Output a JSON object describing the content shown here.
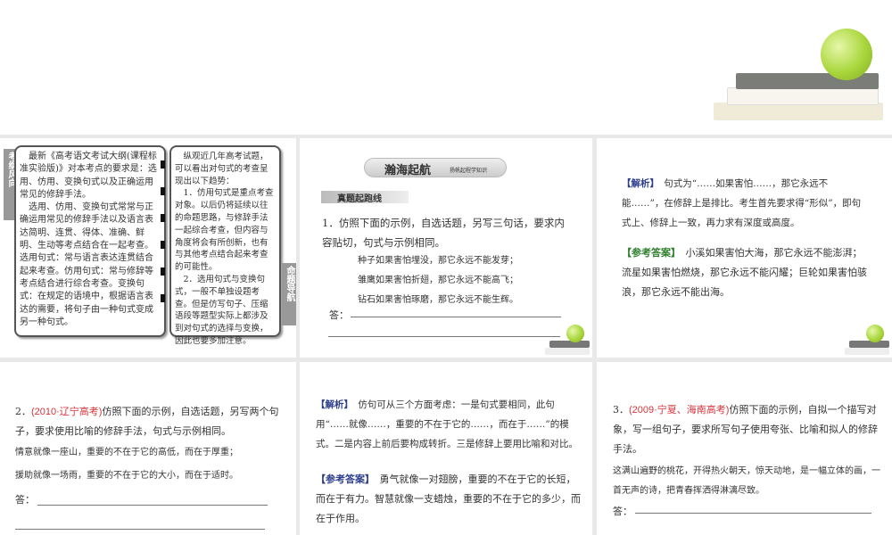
{
  "slide1": {
    "left_tab": "考纲风向",
    "right_tab": "命题导航",
    "left_text": [
      "　最新《高考语文考试大纲(课程标准实验版)》对本考点的要求是：选用、仿用、变换句式以及正确运用常见的修辞手法。",
      "　选用、仿用、变换句式常常与正确运用常见的修辞手法以及语言表达简明、连贯、得体、准确、鲜明、生动等考点结合在一起考查。选用句式：常与语言表达连贯结合起来考查。仿用句式：常与修辞等考点结合进行综合考查。变换句式：在规定的语境中，根据语言表达的需要，将句子由一种句式变成另一种句式。"
    ],
    "right_text": [
      "　纵观近几年高考试题，可以看出对句式的考查呈现出以下趋势：",
      "　1．仿用句式是重点考查对象。以后仍将延续以往的命题思路，与修辞手法一起综合考查，但内容与角度将会有所创新，也有与其他考点结合起来考查的可能性。",
      "　2．选用句式与变换句式，一般不单独设题考查。但是仿写句子、压缩语段等题型实际上都涉及到对句式的选择与变换，因此也要多加注意。"
    ]
  },
  "slide2": {
    "banner_title": "瀚海起航",
    "banner_sub": "扬帆起程学知识",
    "section": "真题起跑线",
    "question": "1．仿照下面的示例，自选话题，另写三句话，要求内容贴切，句式与示例相同。",
    "examples": [
      "种子如果害怕埋没，那它永远不能发芽；",
      "雏鹰如果害怕折翅，那它永远不能高飞；",
      "钻石如果害怕琢磨，那它永远不能生辉。"
    ],
    "answer_label": "答："
  },
  "slide3": {
    "analysis_label": "【解析】",
    "analysis": "句式为“……如果害怕……，那它永远不能……”，在修辞上是排比。考生首先要求得“形似”，即句式上、修辞上一致，再力求有深度或高度。",
    "answer_label": "【参考答案】",
    "answer": "小溪如果害怕大海，那它永远不能澎湃；流星如果害怕燃烧，那它永远不能闪耀；巨轮如果害怕骇浪，那它永远不能出海。"
  },
  "slide4": {
    "number": "2．",
    "source": "(2010·辽宁高考)",
    "question": "仿照下面的示例，自选话题，另写两个句子，要求使用比喻的修辞手法，句式与示例相同。",
    "examples": [
      "情意就像一座山，重要的不在于它的高低，而在于厚重；",
      "援助就像一场雨，重要的不在于它的大小，而在于适时。"
    ],
    "answer_label": "答："
  },
  "slide5": {
    "analysis_label": "【解析】",
    "analysis": "仿句可从三个方面考虑：一是句式要相同，此句用“……就像……，重要的不在于它的……，而在于……”的模式。二是内容上前后要构成转折。三是修辞上要用比喻和对比。",
    "answer_label": "【参考答案】",
    "answer": "勇气就像一对翅膀，重要的不在于它的长短，而在于有力。智慧就像一支蜡烛，重要的不在于它的多少，而在于作用。"
  },
  "slide6": {
    "number": "3．",
    "source": "(2009·宁夏、海南高考)",
    "question": "仿照下面的示例，自拟一个描写对象，写一组句子，要求所写句子使用夸张、比喻和拟人的修辞手法。",
    "example": "这满山遍野的桃花，开得热火朝天，惊天动地，是一幅立体的画，一首无声的诗，把青春挥洒得淋漓尽致。",
    "answer_label": "答："
  }
}
